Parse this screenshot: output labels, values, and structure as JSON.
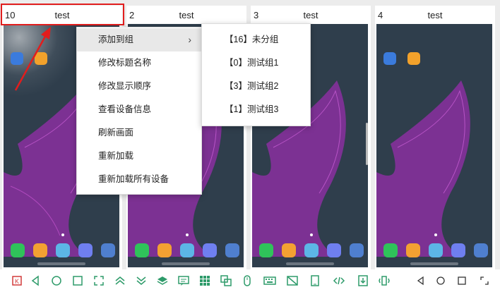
{
  "panels": [
    {
      "number": "10",
      "name": "test"
    },
    {
      "number": "2",
      "name": "test"
    },
    {
      "number": "3",
      "name": "test"
    },
    {
      "number": "4",
      "name": "test"
    }
  ],
  "context_menu": {
    "items": [
      {
        "label": "添加到组",
        "has_submenu": true
      },
      {
        "label": "修改标题名称"
      },
      {
        "label": "修改显示顺序"
      },
      {
        "label": "查看设备信息"
      },
      {
        "label": "刷新画面"
      },
      {
        "label": "重新加载"
      },
      {
        "label": "重新加载所有设备"
      }
    ]
  },
  "submenu": {
    "items": [
      {
        "label": "【16】未分组"
      },
      {
        "label": "【0】测试组1"
      },
      {
        "label": "【3】测试组2"
      },
      {
        "label": "【1】测试组3"
      }
    ]
  },
  "colors": {
    "highlight": "#e21d1d",
    "arrow": "#e21d1d",
    "toolbar_icon": "#2e9b6a",
    "screen_bg": "#2f3e4c"
  },
  "toolbar": {
    "icons": [
      "screenshot-icon",
      "back-icon",
      "home-icon",
      "recents-icon",
      "fullscreen-icon",
      "scroll-up-icon",
      "scroll-down-icon",
      "layers-icon",
      "message-icon",
      "grid-icon",
      "screen-share-icon",
      "mouse-icon",
      "keyboard-icon",
      "no-image-icon",
      "portrait-icon",
      "code-icon",
      "download-icon",
      "vibrate-icon",
      "back-icon-2",
      "home-icon-2",
      "recents-icon-2",
      "fullscreen-icon-2"
    ]
  }
}
